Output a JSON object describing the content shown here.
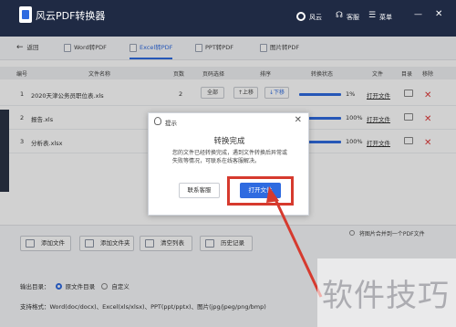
{
  "app": {
    "title": "风云PDF转换器",
    "user": "风云",
    "service": "客服",
    "menu": "菜单"
  },
  "back_label": "返回",
  "tabs": [
    {
      "label": "Word转PDF",
      "active": false
    },
    {
      "label": "Excel转PDF",
      "active": true
    },
    {
      "label": "PPT转PDF",
      "active": false
    },
    {
      "label": "图片转PDF",
      "active": false
    }
  ],
  "table": {
    "headers": [
      "编号",
      "文件名称",
      "页数",
      "页码选择",
      "排序",
      "转换状态",
      "文件",
      "目录",
      "移除"
    ],
    "rows": [
      {
        "no": "1",
        "name": "2020天津公务员职位表.xls",
        "pages": "2",
        "range": "全部",
        "up": "↑上移",
        "down": "↓下移",
        "progress": "1%",
        "open": "打开文件"
      },
      {
        "no": "2",
        "name": "报告.xls",
        "pages": "",
        "range": "",
        "up": "",
        "down": "",
        "progress": "100%",
        "open": "打开文件"
      },
      {
        "no": "3",
        "name": "分析表.xlsx",
        "pages": "",
        "range": "",
        "up": "",
        "down": "",
        "progress": "100%",
        "open": "打开文件"
      }
    ]
  },
  "dialog": {
    "title": "提示",
    "heading": "转换完成",
    "message": "您的文件已经转换完成，遇到文件转换后异常或失败等情况，可联系在线客服解决。",
    "contact": "联系客服",
    "open_file": "打开文件"
  },
  "bottom": {
    "add_file": "添加文件",
    "add_folder": "添加文件夹",
    "clear_list": "清空列表",
    "history": "历史记录",
    "merge": "将图片合并到一个PDF文件",
    "output_label": "输出目录：",
    "output_orig": "原文件目录",
    "output_custom": "自定义",
    "formats": "支持格式：Word(doc/docx)、Excel(xls/xlsx)、PPT(ppt/pptx)、图片(jpg/jpeg/png/bmp)"
  },
  "watermark": "软件技巧",
  "colors": {
    "accent": "#2f6be0",
    "titlebar": "#1f2a44",
    "highlight": "#d63a2e",
    "delete": "#e03a3a"
  }
}
